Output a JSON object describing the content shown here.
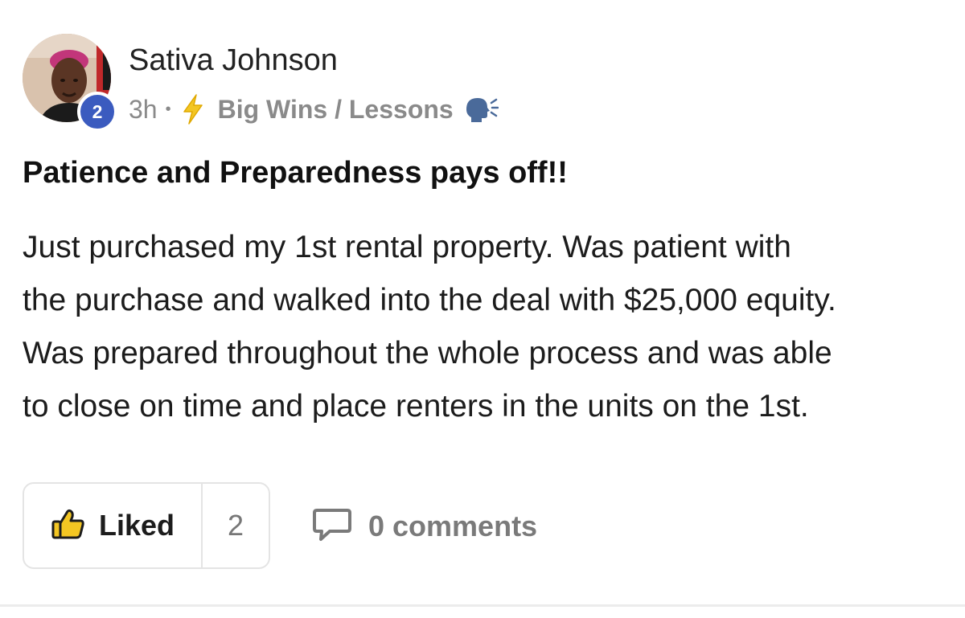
{
  "author": {
    "name": "Sativa Johnson",
    "level": "2"
  },
  "meta": {
    "time": "3h",
    "separator": "•",
    "category_icon": "lightning-bolt-icon",
    "category": "Big Wins / Lessons",
    "category_emoji_icon": "speaking-head-icon"
  },
  "post": {
    "title": "Patience and Preparedness pays off!!",
    "body_lines": [
      "Just purchased my 1st rental property. Was patient with",
      "the purchase and walked into the deal with $25,000 equity.",
      "Was prepared throughout the whole process and was able",
      "to close on time and place renters in the units on the 1st."
    ]
  },
  "actions": {
    "like_label": "Liked",
    "like_count": "2",
    "like_icon": "thumbs-up-icon",
    "comments_label": "0 comments",
    "comments_icon": "speech-bubble-icon"
  },
  "colors": {
    "level_badge": "#3b5bbf",
    "like_icon_fill": "#f3c623",
    "bolt": "#f3c623",
    "muted_text": "#8a8a8a"
  }
}
